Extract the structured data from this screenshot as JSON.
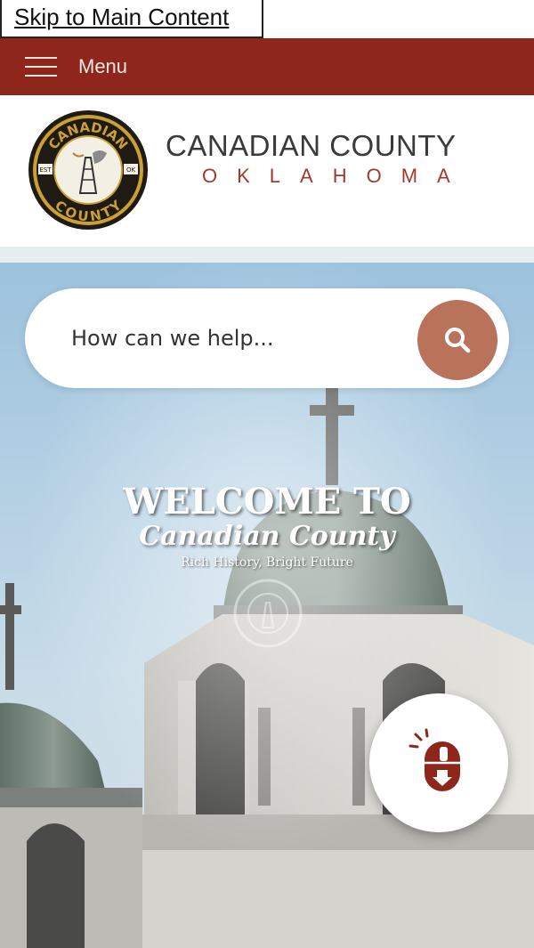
{
  "skip_link": {
    "label": "Skip to Main Content"
  },
  "menu": {
    "label": "Menu"
  },
  "brand": {
    "name": "CANADIAN COUNTY",
    "state": "OKLAHOMA",
    "seal_text_top": "CANADIAN",
    "seal_text_bottom": "COUNTY",
    "seal_left": "EST",
    "seal_right": "OK"
  },
  "search": {
    "placeholder": "How can we help..."
  },
  "hero": {
    "line1": "WELCOME TO",
    "line2": "Canadian County",
    "tagline": "Rich History, Bright Future"
  },
  "colors": {
    "menu_bar": "#8e261c",
    "accent": "#b8735a",
    "brand_red": "#a13a2c"
  },
  "icons": {
    "menu": "hamburger-icon",
    "search": "search-icon",
    "scroll": "mouse-scroll-down-icon"
  }
}
